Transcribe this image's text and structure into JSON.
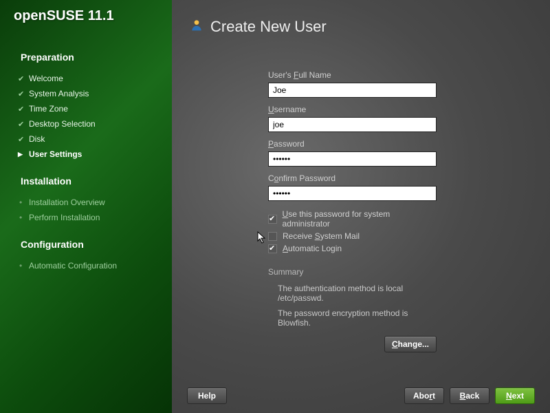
{
  "product": "openSUSE 11.1",
  "page_title": "Create New User",
  "sidebar": {
    "sections": [
      {
        "title": "Preparation",
        "steps": [
          {
            "label": "Welcome",
            "state": "done"
          },
          {
            "label": "System Analysis",
            "state": "done"
          },
          {
            "label": "Time Zone",
            "state": "done"
          },
          {
            "label": "Desktop Selection",
            "state": "done"
          },
          {
            "label": "Disk",
            "state": "done"
          },
          {
            "label": "User Settings",
            "state": "current"
          }
        ]
      },
      {
        "title": "Installation",
        "steps": [
          {
            "label": "Installation Overview",
            "state": "future"
          },
          {
            "label": "Perform Installation",
            "state": "future"
          }
        ]
      },
      {
        "title": "Configuration",
        "steps": [
          {
            "label": "Automatic Configuration",
            "state": "future"
          }
        ]
      }
    ]
  },
  "form": {
    "fullname": {
      "label": "User's Full Name",
      "accel": "F",
      "value": "Joe"
    },
    "username": {
      "label": "Username",
      "accel": "U",
      "value": "joe"
    },
    "password": {
      "label": "Password",
      "accel": "P",
      "value": "••••••"
    },
    "confirm": {
      "label": "Confirm Password",
      "accel": "o",
      "value": "••••••"
    },
    "checks": {
      "sysadmin": {
        "label": "Use this password for system administrator",
        "accel": "U",
        "checked": true
      },
      "sysmail": {
        "label": "Receive System Mail",
        "accel": "S",
        "checked": false
      },
      "autologin": {
        "label": "Automatic Login",
        "accel": "A",
        "checked": true
      }
    }
  },
  "summary": {
    "label": "Summary",
    "lines": [
      "The authentication method is local /etc/passwd.",
      "The password encryption method is Blowfish."
    ]
  },
  "buttons": {
    "change": "Change...",
    "help": "Help",
    "abort": "Abort",
    "back": "Back",
    "next": "Next"
  }
}
